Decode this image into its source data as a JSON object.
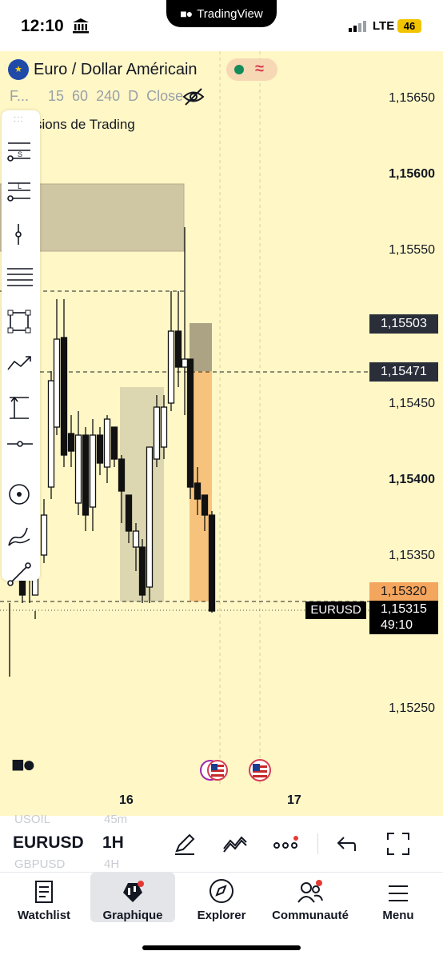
{
  "status_bar": {
    "time": "12:10",
    "carrier_pill": "TradingView",
    "network": "LTE",
    "battery": "46"
  },
  "chart_header": {
    "symbol_title": "Euro / Dollar Américain",
    "intervals": [
      "F...",
      "15",
      "60",
      "240",
      "D",
      "Close"
    ],
    "indicator_label": "sions de Trading",
    "market_status_color": "#138c5a"
  },
  "y_axis": {
    "labels": [
      {
        "text": "1,15650",
        "bold": false
      },
      {
        "text": "1,15600",
        "bold": true
      },
      {
        "text": "1,15550",
        "bold": false
      },
      {
        "text": "1,15450",
        "bold": false
      },
      {
        "text": "1,15400",
        "bold": true
      },
      {
        "text": "1,15350",
        "bold": false
      },
      {
        "text": "1,15250",
        "bold": false
      }
    ],
    "price_boxes": [
      {
        "text": "1,15503",
        "style": "dark"
      },
      {
        "text": "1,15471",
        "style": "dark"
      },
      {
        "text": "1,15320",
        "style": "orange"
      }
    ],
    "last_price": "1,15315",
    "countdown": "49:10",
    "symbol_tag": "EURUSD"
  },
  "x_axis": {
    "labels": [
      "16",
      "17"
    ]
  },
  "drawing_tools": [
    "settings-s-icon",
    "settings-l-icon",
    "vertical-tick-icon",
    "fib-lines-icon",
    "rectangle-icon",
    "trend-arrow-icon",
    "range-measure-icon",
    "horizontal-ray-icon",
    "circle-target-icon",
    "brush-icon",
    "trendline-icon"
  ],
  "symbol_toolbar": {
    "ghost_symbols": [
      "USOIL",
      "45m",
      "GBPUSD",
      "4H"
    ],
    "symbol": "EURUSD",
    "interval": "1H"
  },
  "bottom_nav": [
    {
      "label": "Watchlist",
      "active": false
    },
    {
      "label": "Graphique",
      "active": true
    },
    {
      "label": "Explorer",
      "active": false
    },
    {
      "label": "Communauté",
      "active": false
    },
    {
      "label": "Menu",
      "active": false
    }
  ],
  "colors": {
    "chart_bg": "#fff7c6",
    "zone_orange": "#f7c37c",
    "zone_grey": "#a9ab9a",
    "badge_red": "#e53935"
  }
}
